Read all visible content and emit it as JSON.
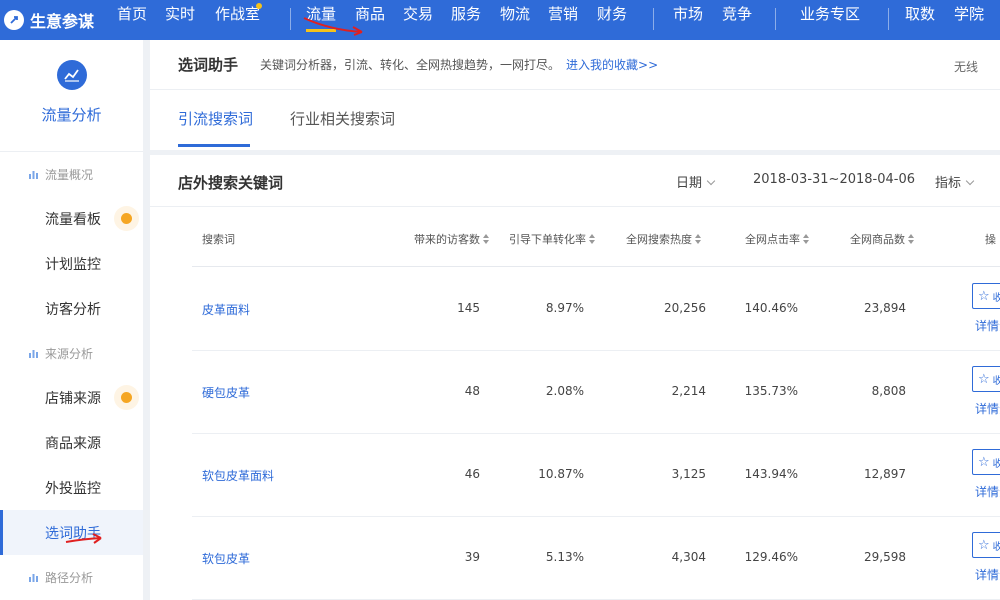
{
  "brand": {
    "name": "生意参谋"
  },
  "nav": {
    "items": [
      {
        "label": "首页"
      },
      {
        "label": "实时"
      },
      {
        "label": "作战室"
      },
      {
        "label": "流量"
      },
      {
        "label": "商品"
      },
      {
        "label": "交易"
      },
      {
        "label": "服务"
      },
      {
        "label": "物流"
      },
      {
        "label": "营销"
      },
      {
        "label": "财务"
      },
      {
        "label": "市场"
      },
      {
        "label": "竞争"
      },
      {
        "label": "业务专区"
      },
      {
        "label": "取数"
      },
      {
        "label": "学院"
      }
    ],
    "active": "流量"
  },
  "sidebar": {
    "title": "流量分析",
    "groups": [
      {
        "label": "流量概况",
        "items": [
          {
            "label": "流量看板"
          },
          {
            "label": "计划监控"
          },
          {
            "label": "访客分析"
          }
        ]
      },
      {
        "label": "来源分析",
        "items": [
          {
            "label": "店铺来源"
          },
          {
            "label": "商品来源"
          },
          {
            "label": "外投监控"
          },
          {
            "label": "选词助手"
          }
        ]
      },
      {
        "label": "路径分析"
      }
    ],
    "active": "选词助手"
  },
  "helper": {
    "title": "选词助手",
    "desc": "关键词分析器，引流、转化、全网热搜趋势，一网打尽。",
    "link": "进入我的收藏>>",
    "right": "无线"
  },
  "tabs": [
    {
      "label": "引流搜索词"
    },
    {
      "label": "行业相关搜索词"
    }
  ],
  "section": {
    "title": "店外搜索关键词",
    "date_label": "日期",
    "date_range": "2018-03-31~2018-04-06",
    "metric_label": "指标"
  },
  "table": {
    "columns": [
      "搜索词",
      "带来的访客数",
      "引导下单转化率",
      "全网搜索热度",
      "全网点击率",
      "全网商品数",
      "操"
    ],
    "rows": [
      {
        "keyword": "皮革面料",
        "visitors": "145",
        "conversion": "8.97%",
        "heat": "20,256",
        "ctr": "140.46%",
        "products": "23,894"
      },
      {
        "keyword": "硬包皮革",
        "visitors": "48",
        "conversion": "2.08%",
        "heat": "2,214",
        "ctr": "135.73%",
        "products": "8,808"
      },
      {
        "keyword": "软包皮革面料",
        "visitors": "46",
        "conversion": "10.87%",
        "heat": "3,125",
        "ctr": "143.94%",
        "products": "12,897"
      },
      {
        "keyword": "软包皮革",
        "visitors": "39",
        "conversion": "5.13%",
        "heat": "4,304",
        "ctr": "129.46%",
        "products": "29,598"
      }
    ],
    "op_btn": "收",
    "op_link": "详情分"
  },
  "colors": {
    "primary": "#2f6bd8",
    "accent": "#f5a623",
    "highlight": "#f5c21a"
  }
}
